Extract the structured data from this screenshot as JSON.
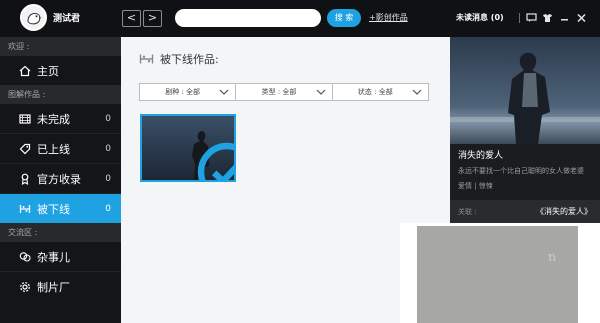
{
  "header": {
    "username": "测试君",
    "back_glyph": "<",
    "forward_glyph": ">",
    "search_placeholder": "",
    "search_button": "搜 索",
    "create_link": "+影创作品",
    "unread": "未读消息 (0)",
    "icons": [
      "comment-icon",
      "shirt-icon",
      "minimize-icon",
      "close-icon"
    ]
  },
  "sidebar": {
    "welcome_head": "欢迎 :",
    "home": "主页",
    "works_head": "图解作品 :",
    "items": [
      {
        "label": "未完成",
        "count": "0",
        "icon": "film-icon"
      },
      {
        "label": "已上线",
        "count": "0",
        "icon": "tag-icon"
      },
      {
        "label": "官方收录",
        "count": "0",
        "icon": "medal-icon"
      },
      {
        "label": "被下线",
        "count": "0",
        "icon": "offline-icon"
      }
    ],
    "community_head": "交流区 :",
    "community": [
      {
        "label": "杂事儿",
        "icon": "chat-icon"
      },
      {
        "label": "制片厂",
        "icon": "gear-icon"
      }
    ]
  },
  "main": {
    "title": "被下线作品:",
    "filters": [
      {
        "label": "剧种 : 全部"
      },
      {
        "label": "类型 : 全部"
      },
      {
        "label": "状态 : 全部"
      }
    ]
  },
  "detail": {
    "title": "消失的爱人",
    "description": "永远不要找一个比自己聪明的女人做老婆",
    "tags": "爱情 | 惊悚",
    "assoc_label": "关联 :",
    "assoc_value": "《消失的爱人》"
  },
  "watermark": {
    "text": "n"
  },
  "colors": {
    "accent": "#1fa2e2",
    "topbar": "#101114",
    "sidebar": "#141518"
  }
}
